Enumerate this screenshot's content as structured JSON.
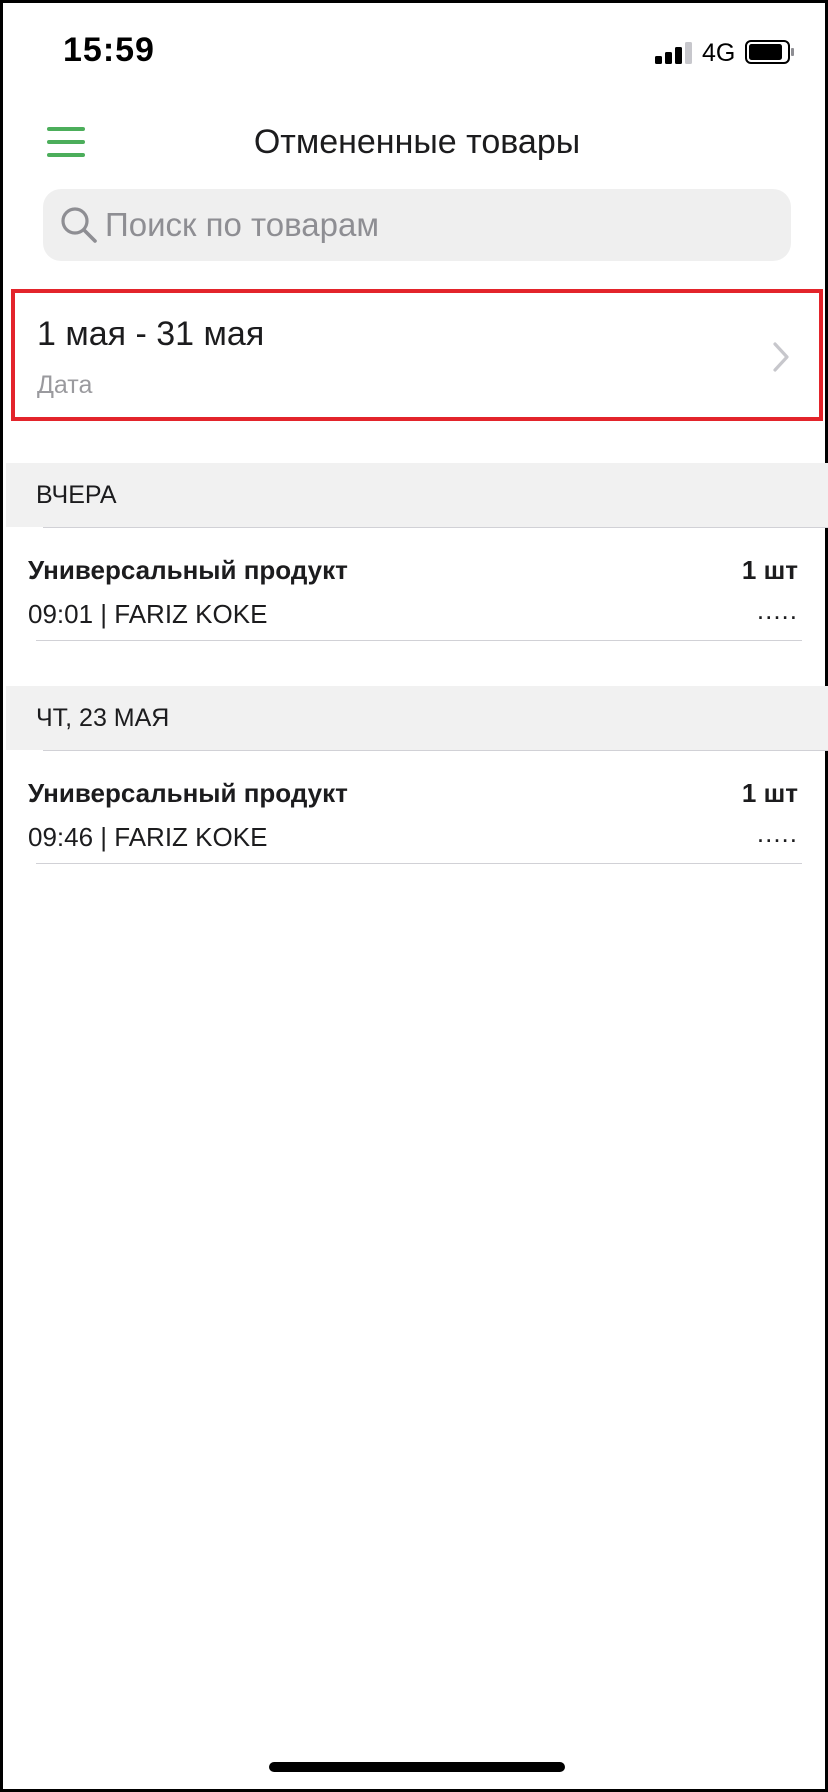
{
  "status_bar": {
    "time": "15:59",
    "network": "4G"
  },
  "header": {
    "title": "Отмененные товары"
  },
  "search": {
    "placeholder": "Поиск по товарам",
    "value": ""
  },
  "date_filter": {
    "range": "1 мая - 31 мая",
    "label": "Дата"
  },
  "sections": [
    {
      "title": "ВЧЕРА",
      "items": [
        {
          "name": "Универсальный продукт",
          "quantity": "1 шт",
          "meta": "09:01 | FARIZ KOKE",
          "more": "....."
        }
      ]
    },
    {
      "title": "ЧТ, 23 МАЯ",
      "items": [
        {
          "name": "Универсальный продукт",
          "quantity": "1 шт",
          "meta": "09:46 | FARIZ KOKE",
          "more": "....."
        }
      ]
    }
  ],
  "colors": {
    "accent": "#4cae5b",
    "highlight_border": "#e3242b",
    "section_bg": "#f1f1f1",
    "search_bg": "#efefef"
  }
}
